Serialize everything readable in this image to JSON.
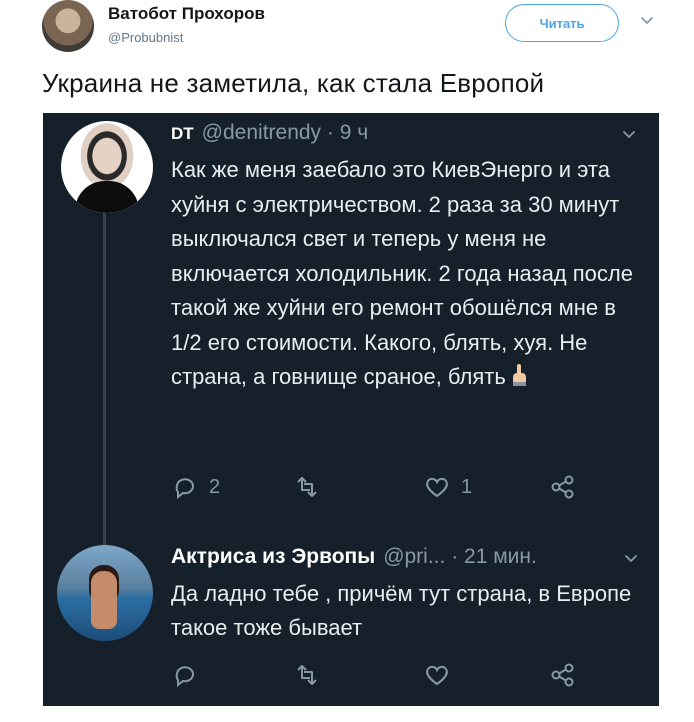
{
  "outer_tweet": {
    "author_name": "Ватобот Прохоров",
    "author_handle": "@Probubnist",
    "follow_label": "Читать",
    "text": "Украина не заметила, как стала Европой"
  },
  "embedded": {
    "tweet1": {
      "display_name": "DT",
      "handle": "@denitrendy",
      "time": "· 9 ч",
      "text": "Как же меня заебало это КиевЭнерго и эта хуйня с электричеством. 2 раза за 30 минут выключался свет и теперь у меня не включается холодильник. 2 года назад после такой же хуйни его ремонт обошёлся мне в 1/2 его стоимости. Какого, блять, хуя. Не страна, а говнище сраное, блять",
      "replies": "2",
      "retweets": "",
      "likes": "1"
    },
    "tweet2": {
      "display_name": "Актриса из Эрвопы",
      "handle": "@pri...",
      "time": "· 21 мин.",
      "text": "Да ладно тебе , причём тут страна, в Европе такое тоже бывает"
    }
  },
  "icons": {
    "reply": "reply-icon",
    "retweet": "retweet-icon",
    "like": "heart-icon",
    "share": "share-icon",
    "caret": "chevron-down-icon"
  },
  "colors": {
    "follow_blue": "#4ea3e3",
    "dark_bg": "#15202b",
    "muted": "#8899a6"
  }
}
